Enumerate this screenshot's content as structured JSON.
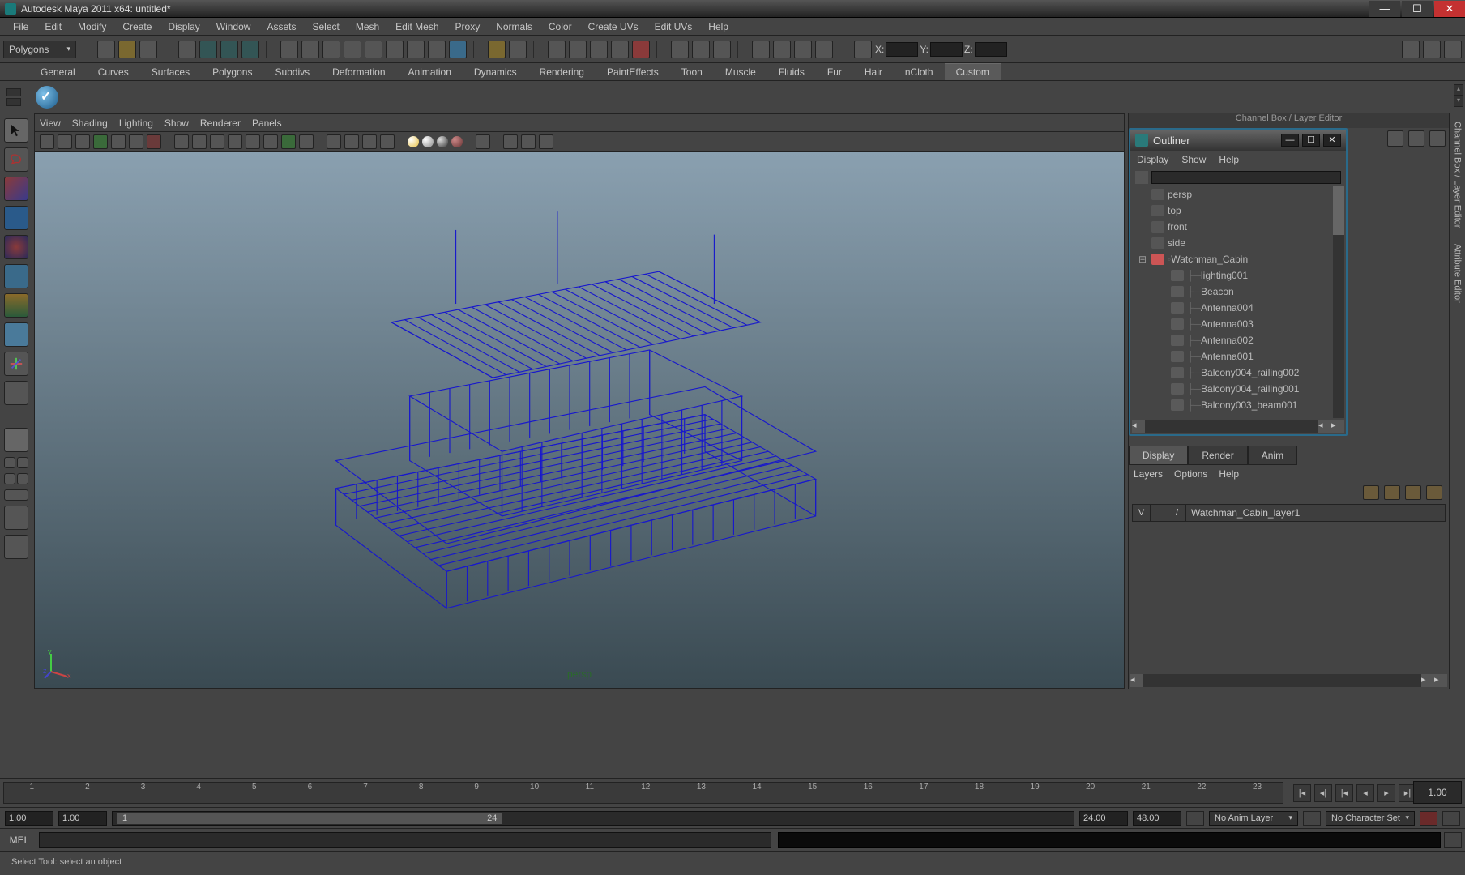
{
  "window": {
    "title": "Autodesk Maya 2011 x64: untitled*"
  },
  "menu": [
    "File",
    "Edit",
    "Modify",
    "Create",
    "Display",
    "Window",
    "Assets",
    "Select",
    "Mesh",
    "Edit Mesh",
    "Proxy",
    "Normals",
    "Color",
    "Create UVs",
    "Edit UVs",
    "Help"
  ],
  "module_selector": "Polygons",
  "xyz_labels": {
    "x": "X:",
    "y": "Y:",
    "z": "Z:"
  },
  "shelf_tabs": [
    "General",
    "Curves",
    "Surfaces",
    "Polygons",
    "Subdivs",
    "Deformation",
    "Animation",
    "Dynamics",
    "Rendering",
    "PaintEffects",
    "Toon",
    "Muscle",
    "Fluids",
    "Fur",
    "Hair",
    "nCloth",
    "Custom"
  ],
  "shelf_active": "Custom",
  "viewport_menu": [
    "View",
    "Shading",
    "Lighting",
    "Show",
    "Renderer",
    "Panels"
  ],
  "viewport_label": "persp",
  "channel_box_title": "Channel Box / Layer Editor",
  "right_tabs": [
    "Channel Box / Layer Editor",
    "Attribute Editor"
  ],
  "outliner": {
    "title": "Outliner",
    "menu": [
      "Display",
      "Show",
      "Help"
    ],
    "items": [
      {
        "indent": 0,
        "type": "cam",
        "name": "persp",
        "exp": ""
      },
      {
        "indent": 0,
        "type": "cam",
        "name": "top",
        "exp": ""
      },
      {
        "indent": 0,
        "type": "cam",
        "name": "front",
        "exp": ""
      },
      {
        "indent": 0,
        "type": "cam",
        "name": "side",
        "exp": ""
      },
      {
        "indent": 0,
        "type": "grp",
        "name": "Watchman_Cabin",
        "exp": "⊟",
        "conn": "◦"
      },
      {
        "indent": 1,
        "type": "mesh",
        "name": "lighting001",
        "conn": "├─"
      },
      {
        "indent": 1,
        "type": "mesh",
        "name": "Beacon",
        "conn": "├─"
      },
      {
        "indent": 1,
        "type": "mesh",
        "name": "Antenna004",
        "conn": "├─"
      },
      {
        "indent": 1,
        "type": "mesh",
        "name": "Antenna003",
        "conn": "├─"
      },
      {
        "indent": 1,
        "type": "mesh",
        "name": "Antenna002",
        "conn": "├─"
      },
      {
        "indent": 1,
        "type": "mesh",
        "name": "Antenna001",
        "conn": "├─"
      },
      {
        "indent": 1,
        "type": "mesh",
        "name": "Balcony004_railing002",
        "conn": "├─"
      },
      {
        "indent": 1,
        "type": "mesh",
        "name": "Balcony004_railing001",
        "conn": "├─"
      },
      {
        "indent": 1,
        "type": "mesh",
        "name": "Balcony003_beam001",
        "conn": "├─"
      }
    ]
  },
  "layer_editor": {
    "tabs": [
      "Display",
      "Render",
      "Anim"
    ],
    "active": "Display",
    "menu": [
      "Layers",
      "Options",
      "Help"
    ],
    "layer": {
      "vis": "V",
      "slash": "/",
      "name": "Watchman_Cabin_layer1"
    }
  },
  "timeline": {
    "ticks": [
      "1",
      "2",
      "3",
      "4",
      "5",
      "6",
      "7",
      "8",
      "9",
      "10",
      "11",
      "12",
      "13",
      "14",
      "15",
      "16",
      "17",
      "18",
      "19",
      "20",
      "21",
      "22",
      "23"
    ],
    "current": "1.00"
  },
  "range": {
    "start_outer": "1.00",
    "start_inner": "1.00",
    "slider_start": "1",
    "slider_end": "24",
    "end_inner": "24.00",
    "end_outer": "48.00",
    "anim_layer": "No Anim Layer",
    "char_set": "No Character Set"
  },
  "mel_label": "MEL",
  "status": "Select Tool: select an object"
}
